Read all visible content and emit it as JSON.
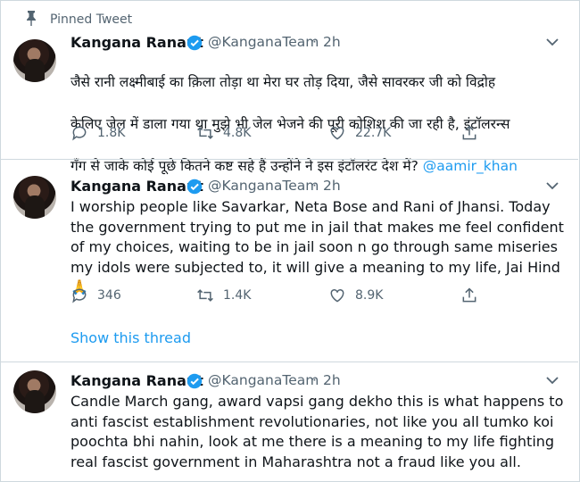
{
  "pinned_label": "Pinned Tweet",
  "tweets": [
    {
      "name": "Kangana Ranaut",
      "handle": "@KanganaTeam",
      "time": "2h",
      "text_lines": [
        "जैसे रानी लक्ष्मीबाई का क़िला तोड़ा था मेरा घर तोड़ दिया, जैसे सावरकर जी को विद्रोह",
        "केलिए जेल में डाला गया था मुझे भी जेल भेजने की पूरी कोशिश की जा रही है, इंटॉलरन्स",
        "गँग से जाके कोई पूछे कितने कष्ट सहे हैं उन्होंने ने इस इंटॉलरंट देश में? "
      ],
      "mention": "@aamir_khan",
      "replies": "1.8K",
      "retweets": "4.8K",
      "likes": "22.7K"
    },
    {
      "name": "Kangana Ranaut",
      "handle": "@KanganaTeam",
      "time": "2h",
      "text": "I worship people like Savarkar, Neta Bose and Rani of Jhansi. Today the government trying to put me in jail that makes me feel confident of my choices, waiting to be in jail soon n go through same miseries my idols were subjected to, it will give a meaning to my life, Jai Hind 🙏",
      "replies": "346",
      "retweets": "1.4K",
      "likes": "8.9K"
    },
    {
      "name": "Kangana Ranaut",
      "handle": "@KanganaTeam",
      "time": "2h",
      "text": "Candle March gang, award vapsi gang dekho this is what happens to anti fascist establishment revolutionaries, not like you all tumko koi poochta bhi nahin, look at me there is a meaning to my life fighting real fascist government in Maharashtra not a fraud like you all."
    }
  ],
  "show_thread": "Show this thread",
  "colors": {
    "accent": "#1d9bf0",
    "secondary": "#536471",
    "border": "#cfd9de"
  }
}
